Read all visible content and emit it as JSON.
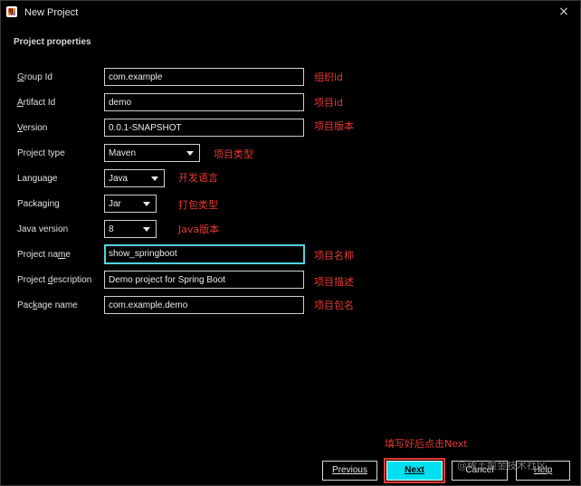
{
  "window": {
    "title": "New Project",
    "close_glyph": "×",
    "icon": "intellij-idea-icon"
  },
  "section_title": "Project properties",
  "rows": [
    {
      "label_pre": "",
      "label_u": "G",
      "label_post": "roup Id",
      "value": "com.example",
      "kind": "text",
      "note": "组织id"
    },
    {
      "label_pre": "",
      "label_u": "A",
      "label_post": "rtifact Id",
      "value": "demo",
      "kind": "text",
      "note": "项目id"
    },
    {
      "label_pre": "",
      "label_u": "V",
      "label_post": "ersion",
      "value": "0.0.1-SNAPSHOT",
      "kind": "text",
      "note": "项目版本"
    },
    {
      "label_pre": "Project type",
      "label_u": "",
      "label_post": "",
      "value": "Maven",
      "kind": "select",
      "note": "项目类型"
    },
    {
      "label_pre": "Language",
      "label_u": "",
      "label_post": "",
      "value": "Java",
      "kind": "select",
      "note": "开发语言"
    },
    {
      "label_pre": "Packaging",
      "label_u": "",
      "label_post": "",
      "value": "Jar",
      "kind": "select",
      "note": "打包类型"
    },
    {
      "label_pre": "Java version",
      "label_u": "",
      "label_post": "",
      "value": "8",
      "kind": "select",
      "note": "Java版本"
    },
    {
      "label_pre": "Project na",
      "label_u": "m",
      "label_post": "e",
      "value": "show_springboot",
      "kind": "text",
      "note": "项目名称"
    },
    {
      "label_pre": "Project ",
      "label_u": "d",
      "label_post": "escription",
      "value": "Demo project for Spring Boot",
      "kind": "text",
      "note": "项目描述"
    },
    {
      "label_pre": "Pac",
      "label_u": "k",
      "label_post": "age name",
      "value": "com.example.demo",
      "kind": "text",
      "note": "项目包名"
    }
  ],
  "footer_note": "填写好后点击Next",
  "buttons": {
    "previous": "Previous",
    "next": "Next",
    "cancel": "Cancel",
    "help": "Help"
  },
  "watermark": "@稀土掘金技术社区",
  "colors": {
    "background": "#000000",
    "annotation": "#e53935",
    "accent": "#00e0f0",
    "focus_border": "#4fd4e6"
  }
}
